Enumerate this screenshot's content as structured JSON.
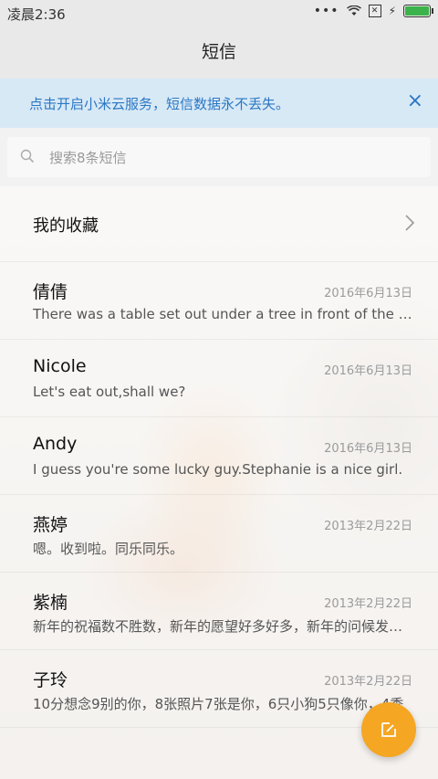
{
  "status_bar": {
    "time": "凌晨2:36",
    "dots": "•••",
    "battery_level": 1.0,
    "icons": [
      "wifi-icon",
      "no-sim-icon",
      "charging-icon",
      "battery-icon"
    ]
  },
  "header": {
    "title": "短信"
  },
  "banner": {
    "text": "点击开启小米云服务，短信数据永不丢失。",
    "close": "×"
  },
  "search": {
    "placeholder": "搜索8条短信"
  },
  "favorites": {
    "label": "我的收藏"
  },
  "conversations": [
    {
      "name": "倩倩",
      "date": "2016年6月13日",
      "preview": "There was a table set out under a tree in front of the house, and the March Hare and the Hatter were having tea at it"
    },
    {
      "name": "Nicole",
      "date": "2016年6月13日",
      "preview": "Let's eat out,shall we?"
    },
    {
      "name": "Andy",
      "date": "2016年6月13日",
      "preview": "I guess you're some lucky guy.Stephanie is a nice girl."
    },
    {
      "name": "燕婷",
      "date": "2013年2月22日",
      "preview": "嗯。收到啦。同乐同乐。"
    },
    {
      "name": "紫楠",
      "date": "2013年2月22日",
      "preview": "新年的祝福数不胜数，新年的愿望好多好多，新年的问候发给你"
    },
    {
      "name": "子玲",
      "date": "2013年2月22日",
      "preview": "10分想念9别的你，8张照片7张是你，6只小狗5只像你，4季"
    }
  ],
  "colors": {
    "accent": "#2a77c4",
    "banner_bg": "#d8e9f6",
    "fab": "#f5a623",
    "battery": "#3cb34a"
  }
}
